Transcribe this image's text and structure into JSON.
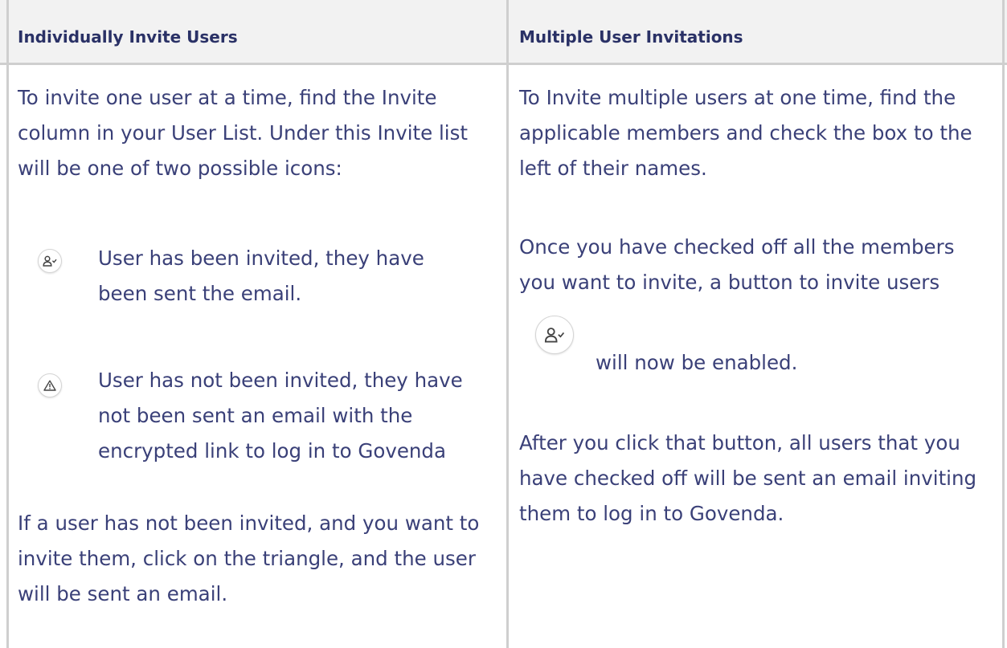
{
  "table": {
    "headers": [
      "Individually Invite Users",
      "Multiple User Invitations"
    ],
    "left": {
      "intro": "To invite one user at a time, find the Invite column in your User List. Under this Invite list will be one of two possible icons:",
      "icon_invited": "user-check-icon",
      "invited_text": "User has been invited, they have been sent the email.",
      "icon_not_invited": "warning-triangle-icon",
      "not_invited_text": "User has not been invited, they have not been sent an email with the encrypted link to log in to Govenda",
      "outro": "If a user has not been invited, and you want to invite them, click on the triangle,  and the user will be sent an email."
    },
    "right": {
      "p1": "To Invite multiple users at one time, find the applicable members and check the box to the left of their names.",
      "p2": "Once you have checked off all the members you want to invite, a button to invite users",
      "invite_button_icon": "user-check-icon",
      "p2_tail": "will now be enabled.",
      "p3": "After you click that button, all users that you have checked off will be sent an email inviting them to log in to Govenda."
    }
  },
  "colors": {
    "text": "#3a4078",
    "header_text": "#2a3166",
    "header_bg": "#f2f2f2",
    "border": "#cfcfcf"
  }
}
